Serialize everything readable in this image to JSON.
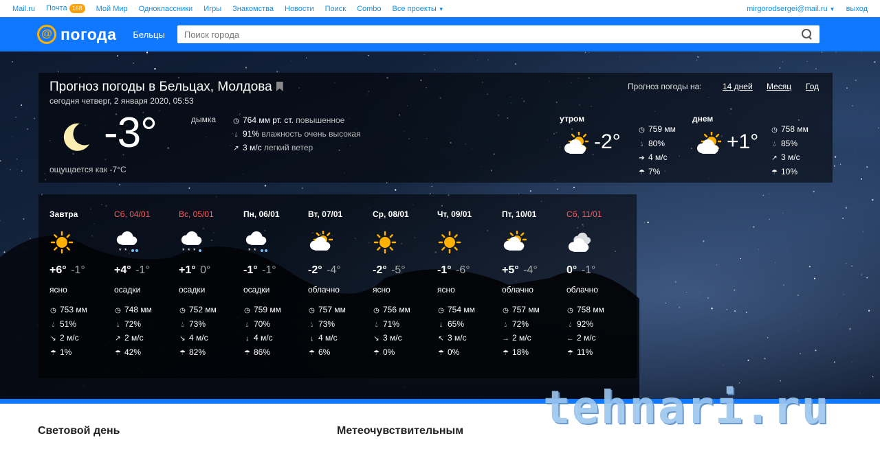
{
  "portal": {
    "links": [
      "Mail.ru",
      "Почта",
      "Мой Мир",
      "Одноклассники",
      "Игры",
      "Знакомства",
      "Новости",
      "Поиск",
      "Combo",
      "Все проекты"
    ],
    "mail_count": "168",
    "user_email": "mirgorodsergei@mail.ru",
    "logout": "выход"
  },
  "header": {
    "logo_text": "погода",
    "city": "Бельцы",
    "search_placeholder": "Поиск города"
  },
  "current": {
    "title": "Прогноз погоды в Бельцах, Молдова",
    "date": "сегодня четверг, 2 января 2020, 05:53",
    "temp": "-3°",
    "condition": "дымка",
    "feels_like": "ощущается как -7°C",
    "pressure": "764 мм рт. ст.",
    "pressure_note": "повышенное",
    "humidity": "91%",
    "humidity_note": "влажность очень высокая",
    "wind": "3 м/с",
    "wind_note": "легкий ветер",
    "periods_label": "Прогноз погоды на:",
    "period_links": [
      "14 дней",
      "Месяц",
      "Год"
    ]
  },
  "parts": [
    {
      "label": "утром",
      "temp": "-2°",
      "pressure": "759 мм",
      "humidity": "80%",
      "wind": "4 м/с",
      "precip": "7%"
    },
    {
      "label": "днем",
      "temp": "+1°",
      "pressure": "758 мм",
      "humidity": "85%",
      "wind": "3 м/с",
      "precip": "10%"
    }
  ],
  "forecast": [
    {
      "label": "Завтра",
      "hi": "+6°",
      "lo": "-1°",
      "cond": "ясно",
      "pressure": "753 мм",
      "humidity": "51%",
      "wind": "2 м/с",
      "precip": "1%",
      "icon": "sun-icon",
      "wind_dir": "↘"
    },
    {
      "label": "Сб, 04/01",
      "hi": "+4°",
      "lo": "-1°",
      "cond": "осадки",
      "pressure": "748 мм",
      "humidity": "72%",
      "wind": "2 м/с",
      "precip": "42%",
      "icon": "snow-rain-icon",
      "wind_dir": "↗"
    },
    {
      "label": "Вс, 05/01",
      "hi": "+1°",
      "lo": "0°",
      "cond": "осадки",
      "pressure": "752 мм",
      "humidity": "73%",
      "wind": "4 м/с",
      "precip": "82%",
      "icon": "snow-icon",
      "wind_dir": "↘"
    },
    {
      "label": "Пн, 06/01",
      "hi": "-1°",
      "lo": "-1°",
      "cond": "осадки",
      "pressure": "759 мм",
      "humidity": "70%",
      "wind": "4 м/с",
      "precip": "86%",
      "icon": "snow-rain-icon",
      "wind_dir": "↓"
    },
    {
      "label": "Вт, 07/01",
      "hi": "-2°",
      "lo": "-4°",
      "cond": "облачно",
      "pressure": "757 мм",
      "humidity": "73%",
      "wind": "4 м/с",
      "precip": "6%",
      "icon": "partly-cloudy-icon",
      "wind_dir": "↓"
    },
    {
      "label": "Ср, 08/01",
      "hi": "-2°",
      "lo": "-5°",
      "cond": "ясно",
      "pressure": "756 мм",
      "humidity": "71%",
      "wind": "3 м/с",
      "precip": "0%",
      "icon": "sun-icon",
      "wind_dir": "↘"
    },
    {
      "label": "Чт, 09/01",
      "hi": "-1°",
      "lo": "-6°",
      "cond": "ясно",
      "pressure": "754 мм",
      "humidity": "65%",
      "wind": "3 м/с",
      "precip": "0%",
      "icon": "sun-icon",
      "wind_dir": "↖"
    },
    {
      "label": "Пт, 10/01",
      "hi": "+5°",
      "lo": "-4°",
      "cond": "облачно",
      "pressure": "757 мм",
      "humidity": "72%",
      "wind": "2 м/с",
      "precip": "18%",
      "icon": "partly-cloudy-icon",
      "wind_dir": "→"
    },
    {
      "label": "Сб, 11/01",
      "hi": "0°",
      "lo": "-1°",
      "cond": "облачно",
      "pressure": "758 мм",
      "humidity": "92%",
      "wind": "2 м/с",
      "precip": "11%",
      "icon": "cloud-icon",
      "wind_dir": "←"
    }
  ],
  "sections": [
    "Световой день",
    "Метеочувствительным"
  ],
  "watermark": "tehnari.ru",
  "colors": {
    "brand_blue": "#0f78ff",
    "weekend_red": "#ff5a5a",
    "sun": "#ffb000",
    "link": "#168de2"
  }
}
